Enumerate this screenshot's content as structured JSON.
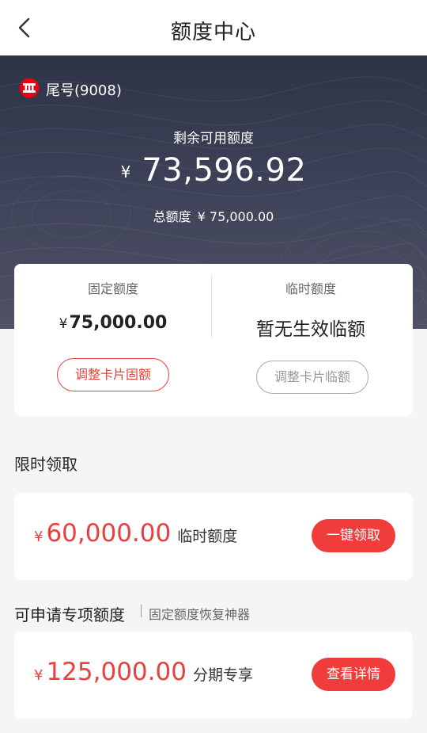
{
  "header": {
    "title": "额度中心",
    "back_icon": "chevron-left-icon"
  },
  "card": {
    "tail_label": "尾号(9008)",
    "logo_icon": "citic-bank-logo-icon",
    "logo_color": "#e60012"
  },
  "summary": {
    "remaining_label": "剩余可用额度",
    "currency": "¥",
    "remaining_amount": "73,596.92",
    "total_label": "总额度",
    "total_amount": "¥ 75,000.00"
  },
  "quota": {
    "fixed": {
      "label": "固定额度",
      "currency": "¥",
      "value": "75,000.00",
      "button": "调整卡片固额"
    },
    "temporary": {
      "label": "临时额度",
      "value": "暂无生效临额",
      "button": "调整卡片临额"
    }
  },
  "limited_offer": {
    "title": "限时领取",
    "currency": "¥",
    "amount": "60,000.00",
    "desc": "临时额度",
    "button": "一键领取"
  },
  "special_offer": {
    "title": "可申请专项额度",
    "subtitle": "固定额度恢复神器",
    "currency": "¥",
    "amount": "125,000.00",
    "desc": "分期专享",
    "button": "查看详情"
  },
  "colors": {
    "accent": "#f03d3c",
    "hero_bg": "#3d4157",
    "page_bg": "#f5f5f5"
  }
}
